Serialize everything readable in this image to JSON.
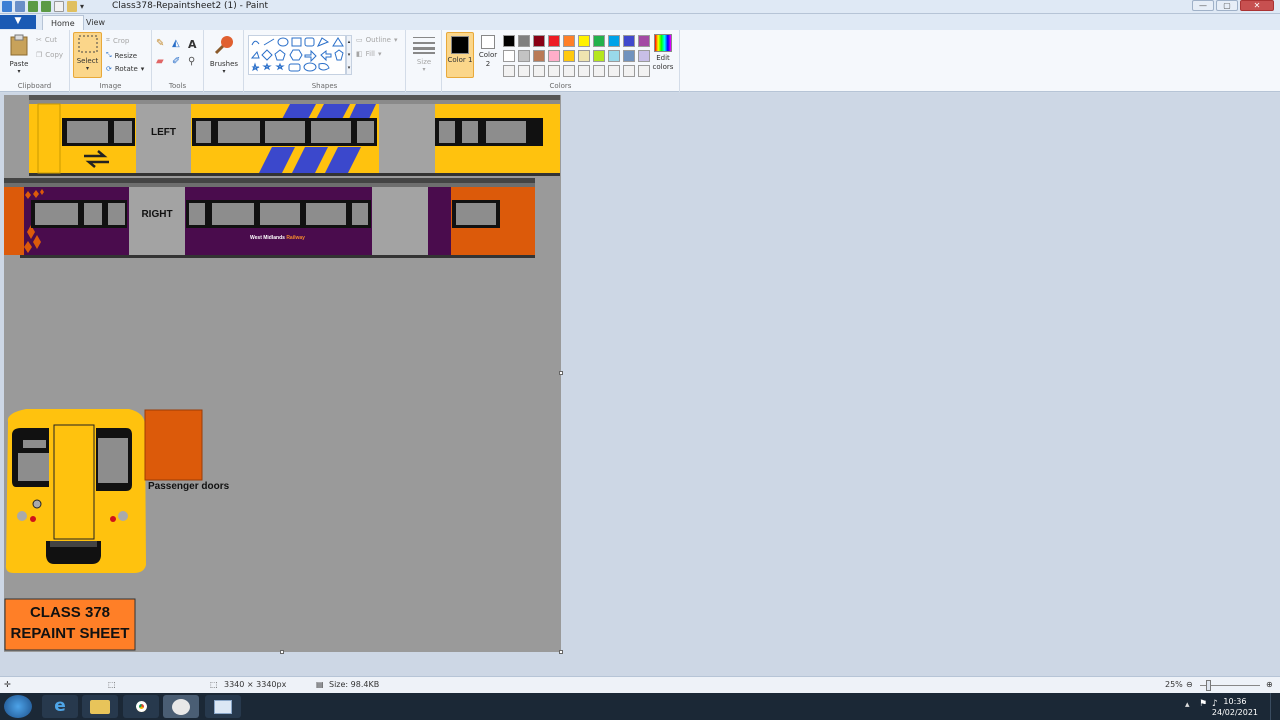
{
  "window": {
    "title": "Class378-Repaintsheet2 (1) - Paint",
    "min": "—",
    "max": "▢",
    "close": "✕"
  },
  "tabs": {
    "file": "▼",
    "home": "Home",
    "view": "View"
  },
  "ribbon": {
    "clipboard": {
      "label": "Clipboard",
      "paste": "Paste",
      "cut": "Cut",
      "copy": "Copy"
    },
    "image": {
      "label": "Image",
      "select": "Select",
      "crop": "Crop",
      "resize": "Resize",
      "rotate": "Rotate"
    },
    "tools": {
      "label": "Tools"
    },
    "brushes": {
      "label": "Brushes"
    },
    "shapes": {
      "label": "Shapes",
      "outline": "Outline",
      "fill": "Fill"
    },
    "size": {
      "label": "Size"
    },
    "colors": {
      "label": "Colors",
      "color1": "Color 1",
      "color2": "Color 2",
      "edit": "Edit colors"
    },
    "palette": [
      "#000000",
      "#7f7f7f",
      "#880015",
      "#ed1c24",
      "#ff7f27",
      "#fff200",
      "#22b14c",
      "#00a2e8",
      "#3f48cc",
      "#a349a4",
      "#ffffff",
      "#c3c3c3",
      "#b97a57",
      "#ffaec9",
      "#ffc90e",
      "#efe4b0",
      "#b5e61d",
      "#99d9ea",
      "#7092be",
      "#c8bfe7",
      "#f2f2f2",
      "#f2f2f2",
      "#f2f2f2",
      "#f2f2f2",
      "#f2f2f2",
      "#f2f2f2",
      "#f2f2f2",
      "#f2f2f2",
      "#f2f2f2",
      "#f2f2f2"
    ]
  },
  "canvas": {
    "left_label": "LEFT",
    "right_label": "RIGHT",
    "wmr_name": "West Midlands",
    "wmr_railway": "Railway",
    "doors_label": "Passenger doors",
    "sheet_title_1": "CLASS 378",
    "sheet_title_2": "REPAINT SHEET",
    "colors": {
      "yellow": "#ffc20e",
      "purple": "#4a0c4d",
      "orange": "#dc5a0a",
      "door_grey": "#a3a3a3",
      "blue_stripe": "#3b48cc",
      "sheet_orange": "#ff7f27"
    }
  },
  "status": {
    "dimensions": "3340 × 3340px",
    "size": "Size: 98.4KB",
    "zoom": "25%"
  },
  "taskbar": {
    "time": "10:36",
    "date": "24/02/2021"
  }
}
